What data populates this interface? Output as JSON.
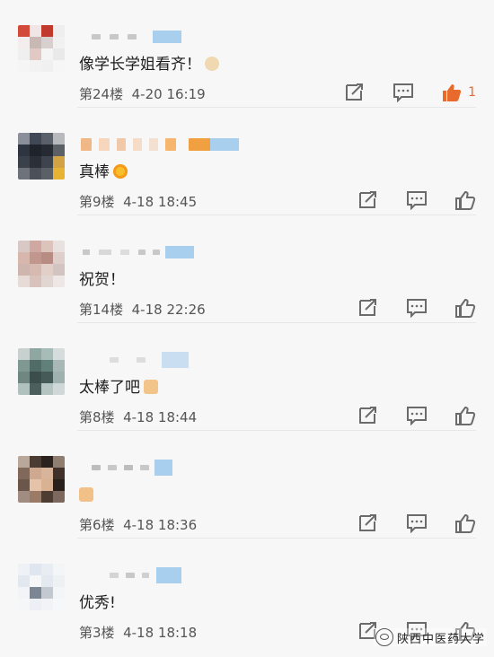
{
  "comments": [
    {
      "text": "像学长学姐看齐！",
      "emoji": "fist-emoji",
      "floor": "第24楼",
      "time": "4-20 16:19",
      "likes": "1",
      "liked": true
    },
    {
      "text": "真棒",
      "emoji": "heart-eyes-emoji",
      "floor": "第9楼",
      "time": "4-18 18:45",
      "likes": "",
      "liked": false
    },
    {
      "text": "祝贺！",
      "emoji": "",
      "floor": "第14楼",
      "time": "4-18 22:26",
      "likes": "",
      "liked": false
    },
    {
      "text": "太棒了吧",
      "emoji": "thumbs-up-emoji",
      "floor": "第8楼",
      "time": "4-18 18:44",
      "likes": "",
      "liked": false
    },
    {
      "text": "",
      "emoji": "muscle-emoji",
      "floor": "第6楼",
      "time": "4-18 18:36",
      "likes": "",
      "liked": false
    },
    {
      "text": "优秀!",
      "emoji": "",
      "floor": "第3楼",
      "time": "4-18 18:18",
      "likes": "",
      "liked": false
    }
  ],
  "watermark": {
    "text": "陕西中医药大学"
  },
  "colors": {
    "liked": "#e86a2c",
    "icon": "#6b6b6b",
    "badge": "#a9cfee"
  }
}
